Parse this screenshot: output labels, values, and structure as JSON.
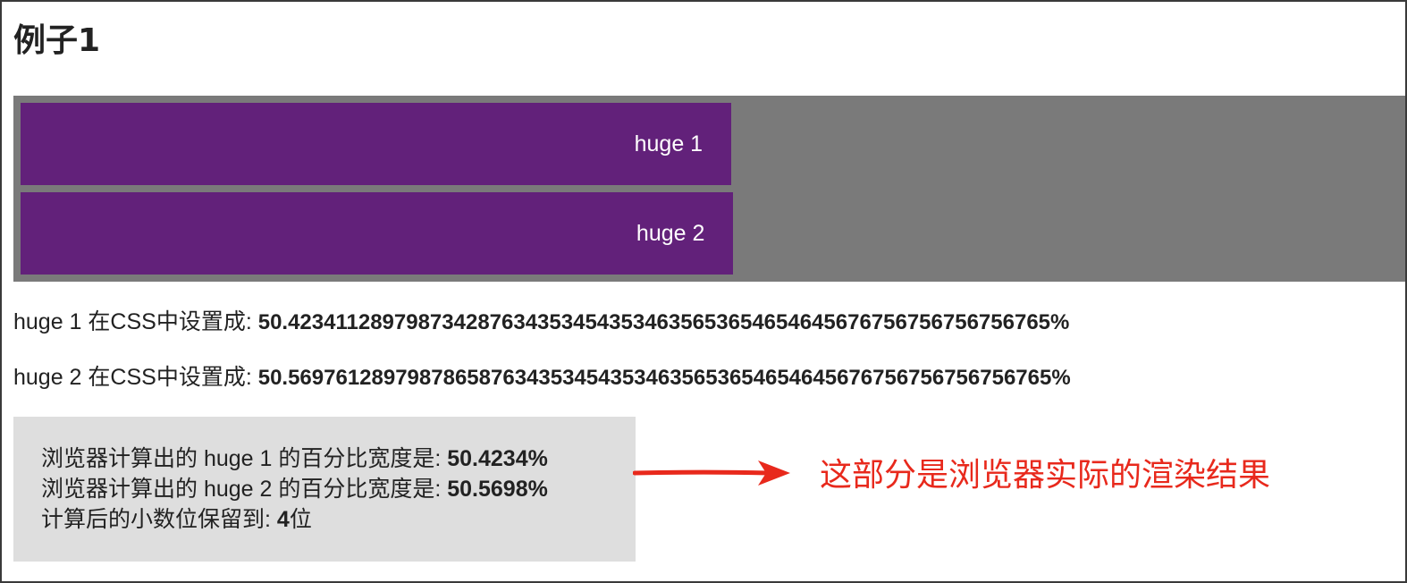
{
  "page": {
    "title": "例子1"
  },
  "bars": [
    {
      "label": "huge 1",
      "width_percent": 50.4234
    },
    {
      "label": "huge 2",
      "width_percent": 50.5698
    }
  ],
  "css_settings": [
    {
      "prefix": "huge 1 在CSS中设置成: ",
      "value": "50.4234112897987342876343534543534635653654654645676756756756756765%"
    },
    {
      "prefix": "huge 2 在CSS中设置成: ",
      "value": "50.5697612897987865876343534543534635653654654645676756756756756765%"
    }
  ],
  "result": {
    "line1_prefix": "浏览器计算出的 huge 1 的百分比宽度是: ",
    "line1_value": "50.4234%",
    "line2_prefix": "浏览器计算出的 huge 2 的百分比宽度是: ",
    "line2_value": "50.5698%",
    "line3_prefix": "计算后的小数位保留到: ",
    "line3_value": "4",
    "line3_suffix": "位"
  },
  "annotation": {
    "text": "这部分是浏览器实际的渲染结果"
  },
  "colors": {
    "bar": "#62217a",
    "container": "#7a7a7a",
    "result_box": "#dedede",
    "annotation": "#e8291c",
    "arrow": "#e8291c"
  }
}
